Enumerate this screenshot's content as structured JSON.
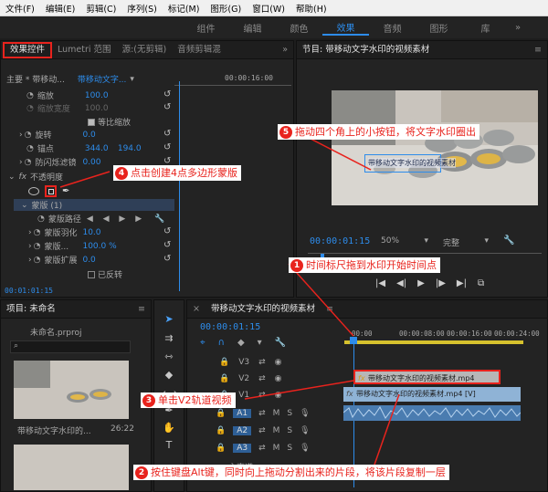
{
  "menu": [
    "文件(F)",
    "编辑(E)",
    "剪辑(C)",
    "序列(S)",
    "标记(M)",
    "图形(G)",
    "窗口(W)",
    "帮助(H)"
  ],
  "workspaces": [
    {
      "label": "组件",
      "active": false
    },
    {
      "label": "编辑",
      "active": false
    },
    {
      "label": "颜色",
      "active": false
    },
    {
      "label": "效果",
      "active": true
    },
    {
      "label": "音频",
      "active": false
    },
    {
      "label": "图形",
      "active": false
    },
    {
      "label": "库",
      "active": false
    }
  ],
  "effect_controls": {
    "tabs": [
      "效果控件",
      "Lumetri 范围",
      "源:(无剪辑)",
      "音频剪辑混"
    ],
    "master": "主要 * 带移动...",
    "clip": "带移动文字...",
    "ruler_time": "00:00:16:00",
    "scale_label": "缩放",
    "scale_value": "100.0",
    "scale_width_label": "缩放宽度",
    "scale_width_value": "100.0",
    "uniform_label": "等比缩放",
    "rotation_label": "旋转",
    "rotation_value": "0.0",
    "anchor_label": "锚点",
    "anchor_x": "344.0",
    "anchor_y": "194.0",
    "flicker_label": "防闪烁滤镜",
    "flicker_value": "0.00",
    "opacity_label": "不透明度",
    "mask_label": "蒙版 (1)",
    "mask_path_label": "蒙版路径",
    "mask_feather_label": "蒙版羽化",
    "mask_feather_value": "10.0",
    "mask_opacity_label": "蒙版...",
    "mask_opacity_value": "100.0 %",
    "mask_expand_label": "蒙版扩展",
    "mask_expand_value": "0.0",
    "inverted_label": "已反转",
    "timecode": "00:01:01:15"
  },
  "program": {
    "title": "节目: 带移动文字水印的视频素材",
    "timecode": "00:00:01:15",
    "zoom": "50%",
    "quality": "完整",
    "watermark_text": "带移动文字水印的视频素材"
  },
  "project": {
    "title": "项目: 未命名",
    "file": "未命名.prproj",
    "items": [
      {
        "name": "带移动文字水印的...",
        "duration": "26:22"
      }
    ]
  },
  "timeline": {
    "title": "带移动文字水印的视频素材",
    "timecode": "00:00:01:15",
    "ruler": [
      "00:00",
      "00:00:08:00",
      "00:00:16:00",
      "00:00:24:00"
    ],
    "tracks": [
      "V3",
      "V2",
      "V1",
      "A1",
      "A2",
      "A3"
    ],
    "clip_v2": "带移动文字水印的视频素材.mp4",
    "clip_v1": "带移动文字水印的视频素材.mp4 [V]",
    "track_master": "主声道"
  },
  "callouts": {
    "c1": {
      "num": "1",
      "text": "时间标尺拖到水印开始时间点"
    },
    "c2": {
      "num": "2",
      "text": "按住键盘Alt键，同时向上拖动分割出来的片段，将该片段复制一层"
    },
    "c3": {
      "num": "3",
      "text": "单击V2轨道视频"
    },
    "c4": {
      "num": "4",
      "text": "点击创建4点多边形蒙版"
    },
    "c5": {
      "num": "5",
      "text": "拖动四个角上的小按钮，将文字水印圈出"
    }
  },
  "colors": {
    "accent": "#2d8ceb",
    "callout": "#e8231d",
    "clip_v2": "#b7b7b7",
    "clip_v1": "#8fb3d6",
    "audio": "#4a7cb0"
  }
}
